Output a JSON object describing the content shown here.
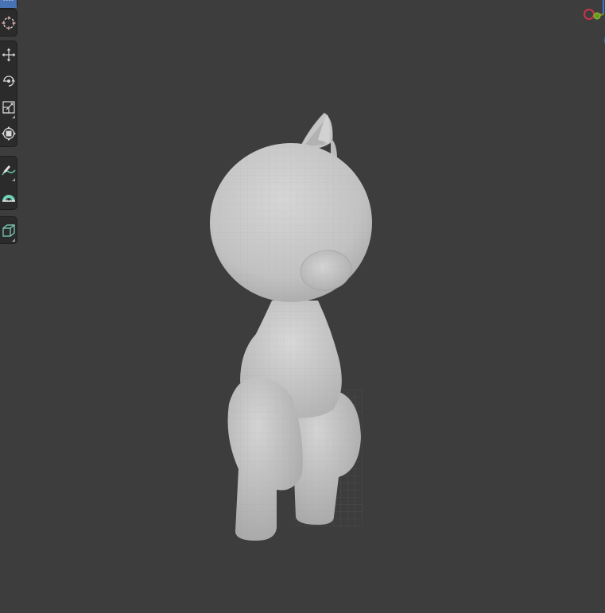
{
  "viewport": {
    "background": "#3d3d3d",
    "object": "cartoon-character-mesh"
  },
  "toolbar": {
    "groups": [
      {
        "tools": [
          {
            "icon": "select-box-icon",
            "active": true
          }
        ]
      },
      {
        "tools": [
          {
            "icon": "cursor-icon",
            "active": false
          }
        ]
      },
      {
        "tools": [
          {
            "icon": "move-icon",
            "active": false
          },
          {
            "icon": "rotate-icon",
            "active": false
          },
          {
            "icon": "scale-icon",
            "active": false
          },
          {
            "icon": "transform-icon",
            "active": false
          }
        ]
      },
      {
        "tools": [
          {
            "icon": "annotate-icon",
            "active": false
          },
          {
            "icon": "measure-icon",
            "active": false
          }
        ]
      },
      {
        "tools": [
          {
            "icon": "add-cube-icon",
            "active": false
          }
        ]
      }
    ]
  },
  "gizmo": {
    "x_color": "#c8354a",
    "y_color": "#6a9a1f",
    "z_color": "#3a78c6"
  },
  "colors": {
    "toolbar_bg": "#2b2b2b",
    "active_tool": "#4772b3",
    "mesh": "#c7c7c7"
  }
}
